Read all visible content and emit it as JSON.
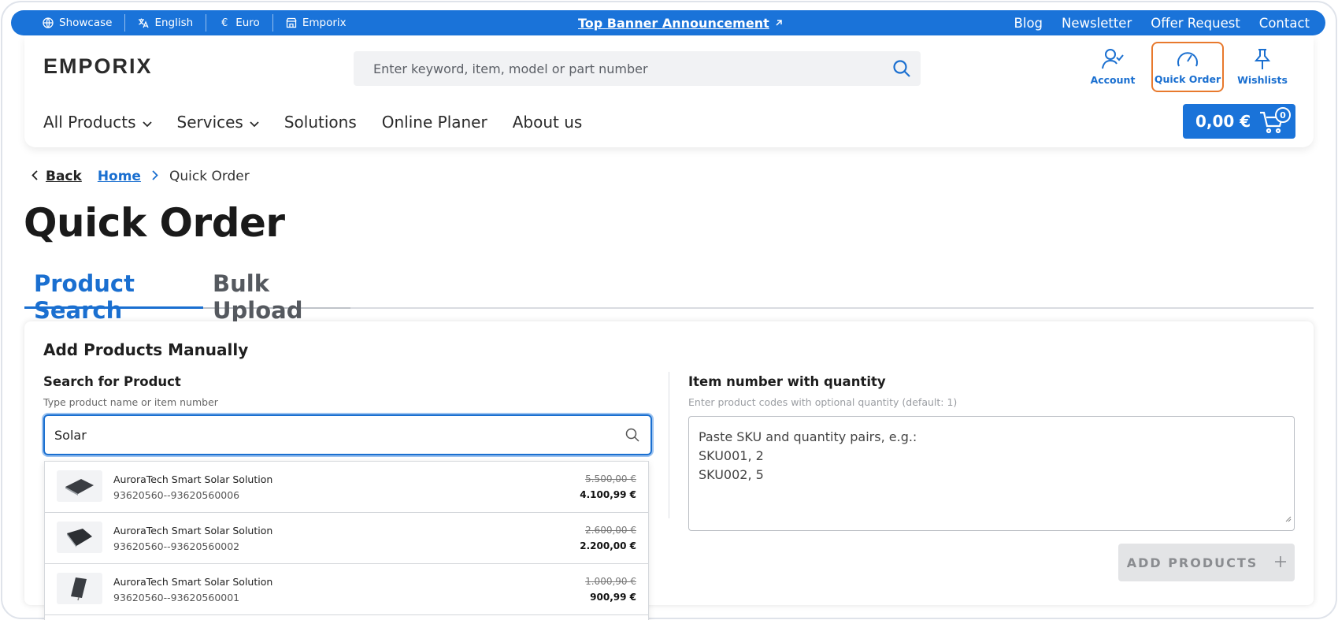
{
  "topbar": {
    "items": [
      {
        "label": "Showcase",
        "icon": "globe-icon"
      },
      {
        "label": "English",
        "icon": "translate-icon"
      },
      {
        "label": "Euro",
        "icon": "euro-icon"
      },
      {
        "label": "Emporix",
        "icon": "store-icon"
      }
    ],
    "announcement": "Top Banner Announcement",
    "links": [
      "Blog",
      "Newsletter",
      "Offer Request",
      "Contact"
    ]
  },
  "header": {
    "logo": "EMPORIX",
    "search_placeholder": "Enter keyword, item, model or part number",
    "actions": [
      {
        "label": "Account",
        "icon": "account-icon"
      },
      {
        "label": "Quick Order",
        "icon": "speedometer-icon"
      },
      {
        "label": "Wishlists",
        "icon": "pin-icon"
      }
    ],
    "nav": [
      {
        "label": "All Products",
        "dropdown": true
      },
      {
        "label": "Services",
        "dropdown": true
      },
      {
        "label": "Solutions",
        "dropdown": false
      },
      {
        "label": "Online Planer",
        "dropdown": false
      },
      {
        "label": "About us",
        "dropdown": false
      }
    ],
    "cart_total": "0,00 €",
    "cart_count": "0"
  },
  "breadcrumb": {
    "back": "Back",
    "home": "Home",
    "current": "Quick Order"
  },
  "page_title": "Quick Order",
  "tabs": [
    {
      "label": "Product Search",
      "active": true
    },
    {
      "label": "Bulk Upload",
      "active": false
    }
  ],
  "card": {
    "title": "Add Products Manually",
    "search_label": "Search for Product",
    "search_hint": "Type product name or item number",
    "search_value": "Solar",
    "bulk_label": "Item number with quantity",
    "bulk_hint": "Enter product codes with optional quantity (default: 1)",
    "bulk_placeholder_lines": [
      "Paste SKU and quantity pairs, e.g.:",
      "SKU001, 2",
      "SKU002, 5"
    ],
    "add_button": "ADD PRODUCTS"
  },
  "results": [
    {
      "name": "AuroraTech Smart Solar Solution",
      "sku": "93620560--93620560006",
      "old_price": "5.500,00 €",
      "price": "4.100,99 €"
    },
    {
      "name": "AuroraTech Smart Solar Solution",
      "sku": "93620560--93620560002",
      "old_price": "2.600,00 €",
      "price": "2.200,00 €"
    },
    {
      "name": "AuroraTech Smart Solar Solution",
      "sku": "93620560--93620560001",
      "old_price": "1.000,90 €",
      "price": "900,99 €"
    }
  ],
  "colors": {
    "brand": "#1a73d9",
    "focus": "#e8792d"
  }
}
